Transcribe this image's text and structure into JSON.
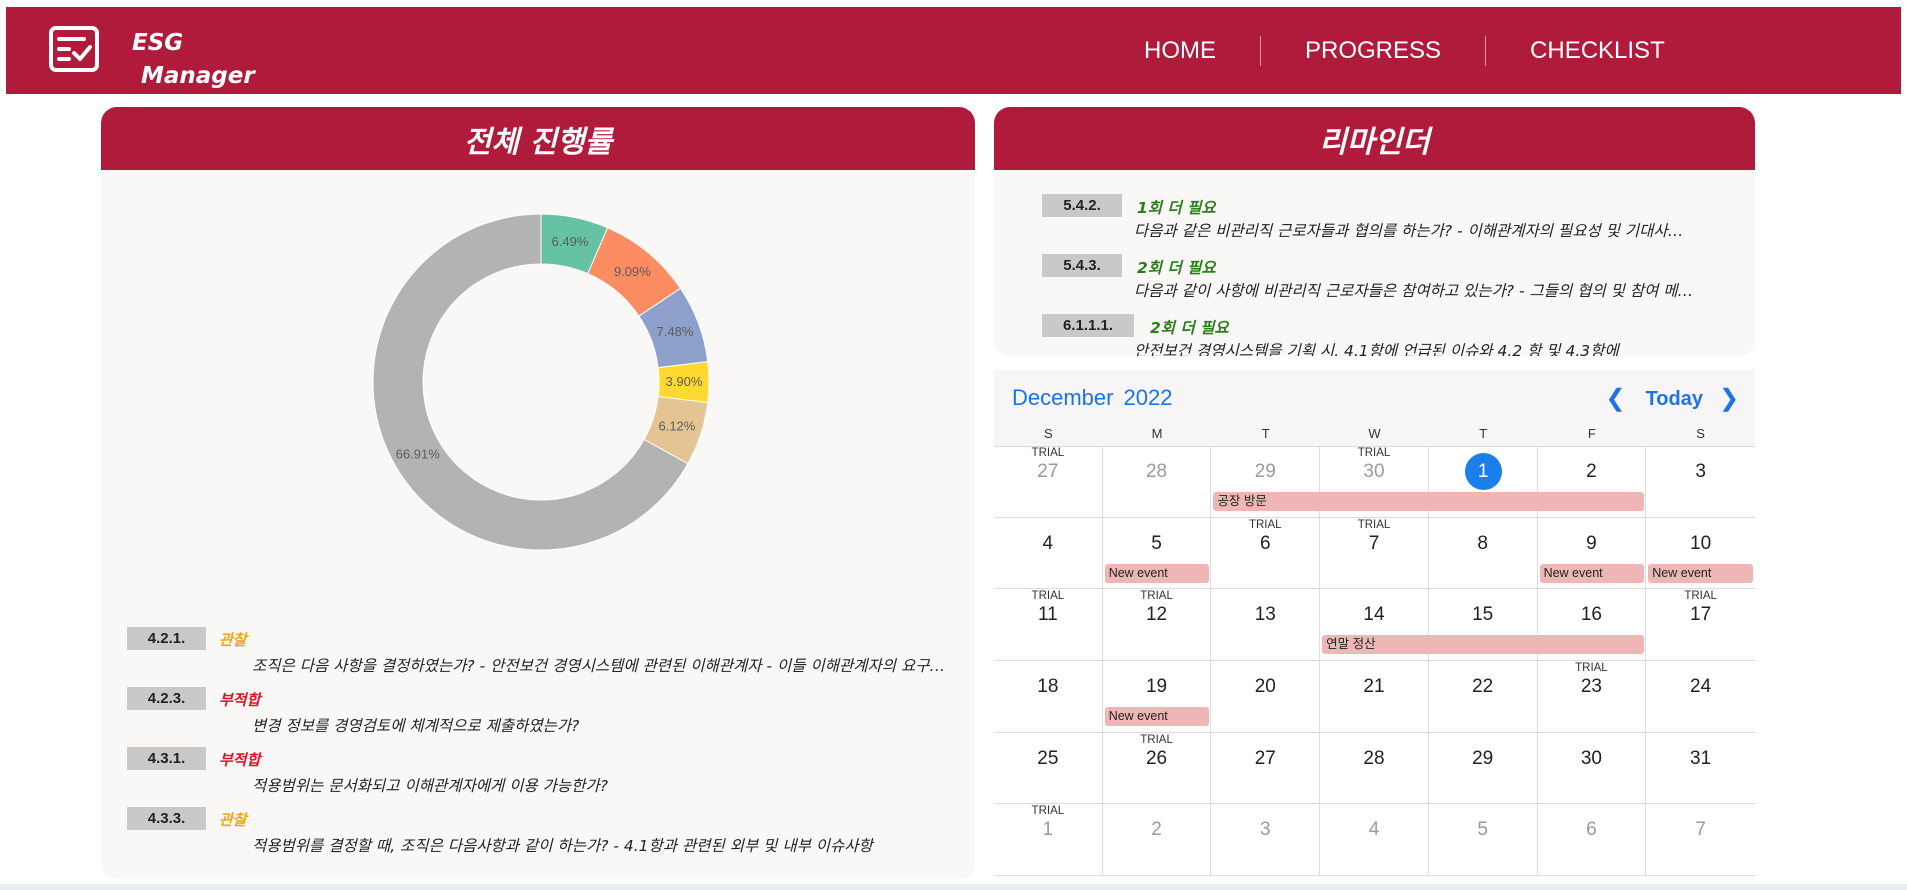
{
  "header": {
    "brand_line1": "ESG",
    "brand_line2": "Manager",
    "nav": {
      "home": "HOME",
      "progress": "PROGRESS",
      "checklist": "CHECKLIST"
    },
    "color": "#b01b3b"
  },
  "progress_panel": {
    "title": "전체 진행률",
    "items": [
      {
        "code": "4.2.1.",
        "status": "관찰",
        "status_type": "observation",
        "desc": "조직은 다음 사항을 결정하였는가? - 안전보건 경영시스템에 관련된 이해관계자 - 이들 이해관계자의 요구사항"
      },
      {
        "code": "4.2.3.",
        "status": "부적합",
        "status_type": "nonconformity",
        "desc": "변경 정보를 경영검토에 체계적으로 제출하였는가?"
      },
      {
        "code": "4.3.1.",
        "status": "부적합",
        "status_type": "nonconformity",
        "desc": "적용범위는 문서화되고 이해관계자에게 이용 가능한가?"
      },
      {
        "code": "4.3.3.",
        "status": "관찰",
        "status_type": "observation",
        "desc": "적용범위를 결정할 때, 조직은 다음사항과 같이 하는가? - 4.1항과 관련된 외부 및 내부 이슈사항"
      }
    ]
  },
  "chart_data": {
    "type": "pie",
    "donut": true,
    "labels": [
      "6.49%",
      "9.09%",
      "7.48%",
      "3.90%",
      "6.12%",
      "66.91%"
    ],
    "values": [
      6.49,
      9.09,
      7.48,
      3.9,
      6.12,
      66.91
    ],
    "colors": [
      "#66c2a5",
      "#fc8d62",
      "#8da0cb",
      "#ffd92f",
      "#e5c494",
      "#b3b3b3"
    ]
  },
  "reminder_panel": {
    "title": "리마인더",
    "items": [
      {
        "code": "5.4.2.",
        "status": "1회 더 필요",
        "desc": "다음과 같은 비관리직 근로자들과 협의를 하는가? - 이해관계자의 필요성 및 기대사항 결정"
      },
      {
        "code": "5.4.3.",
        "status": "2회 더 필요",
        "desc": "다음과 같이 사항에 비관리직 근로자들은 참여하고 있는가? - 그들의 협의 및 참여 메커니즘 결정"
      },
      {
        "code": "6.1.1.1.",
        "status": "2회 더 필요",
        "desc": "안전보건 경영시스템을 기획 시, 4.1항에 언급된 이슈와 4.2 항 및 4.3항에"
      }
    ]
  },
  "calendar": {
    "month": "December",
    "year": "2022",
    "today_label": "Today",
    "prev_icon": "chevron-left-icon",
    "next_icon": "chevron-right-icon",
    "trial_label": "TRIAL",
    "weekdays": [
      "S",
      "M",
      "T",
      "W",
      "T",
      "F",
      "S"
    ],
    "weeks": [
      [
        {
          "d": "27",
          "other": true,
          "trial": true
        },
        {
          "d": "28",
          "other": true
        },
        {
          "d": "29",
          "other": true
        },
        {
          "d": "30",
          "other": true,
          "trial": true
        },
        {
          "d": "1",
          "today": true
        },
        {
          "d": "2"
        },
        {
          "d": "3"
        }
      ],
      [
        {
          "d": "4"
        },
        {
          "d": "5"
        },
        {
          "d": "6",
          "trial": true
        },
        {
          "d": "7",
          "trial": true
        },
        {
          "d": "8"
        },
        {
          "d": "9"
        },
        {
          "d": "10"
        }
      ],
      [
        {
          "d": "11",
          "trial": true
        },
        {
          "d": "12",
          "trial": true
        },
        {
          "d": "13"
        },
        {
          "d": "14"
        },
        {
          "d": "15"
        },
        {
          "d": "16"
        },
        {
          "d": "17",
          "trial": true
        }
      ],
      [
        {
          "d": "18"
        },
        {
          "d": "19"
        },
        {
          "d": "20"
        },
        {
          "d": "21"
        },
        {
          "d": "22"
        },
        {
          "d": "23",
          "trial": true
        },
        {
          "d": "24"
        }
      ],
      [
        {
          "d": "25"
        },
        {
          "d": "26",
          "trial": true
        },
        {
          "d": "27"
        },
        {
          "d": "28"
        },
        {
          "d": "29"
        },
        {
          "d": "30"
        },
        {
          "d": "31"
        }
      ],
      [
        {
          "d": "1",
          "other": true,
          "trial": true
        },
        {
          "d": "2",
          "other": true
        },
        {
          "d": "3",
          "other": true
        },
        {
          "d": "4",
          "other": true
        },
        {
          "d": "5",
          "other": true
        },
        {
          "d": "6",
          "other": true
        },
        {
          "d": "7",
          "other": true
        }
      ]
    ],
    "events": [
      {
        "title": "공장 방문",
        "week": 0,
        "start": 2,
        "end": 5
      },
      {
        "title": "New event",
        "week": 1,
        "start": 1,
        "end": 1
      },
      {
        "title": "New event",
        "week": 1,
        "start": 5,
        "end": 5
      },
      {
        "title": "New event",
        "week": 1,
        "start": 6,
        "end": 6
      },
      {
        "title": "연말 정산",
        "week": 2,
        "start": 3,
        "end": 5
      },
      {
        "title": "New event",
        "week": 3,
        "start": 1,
        "end": 1
      }
    ]
  }
}
